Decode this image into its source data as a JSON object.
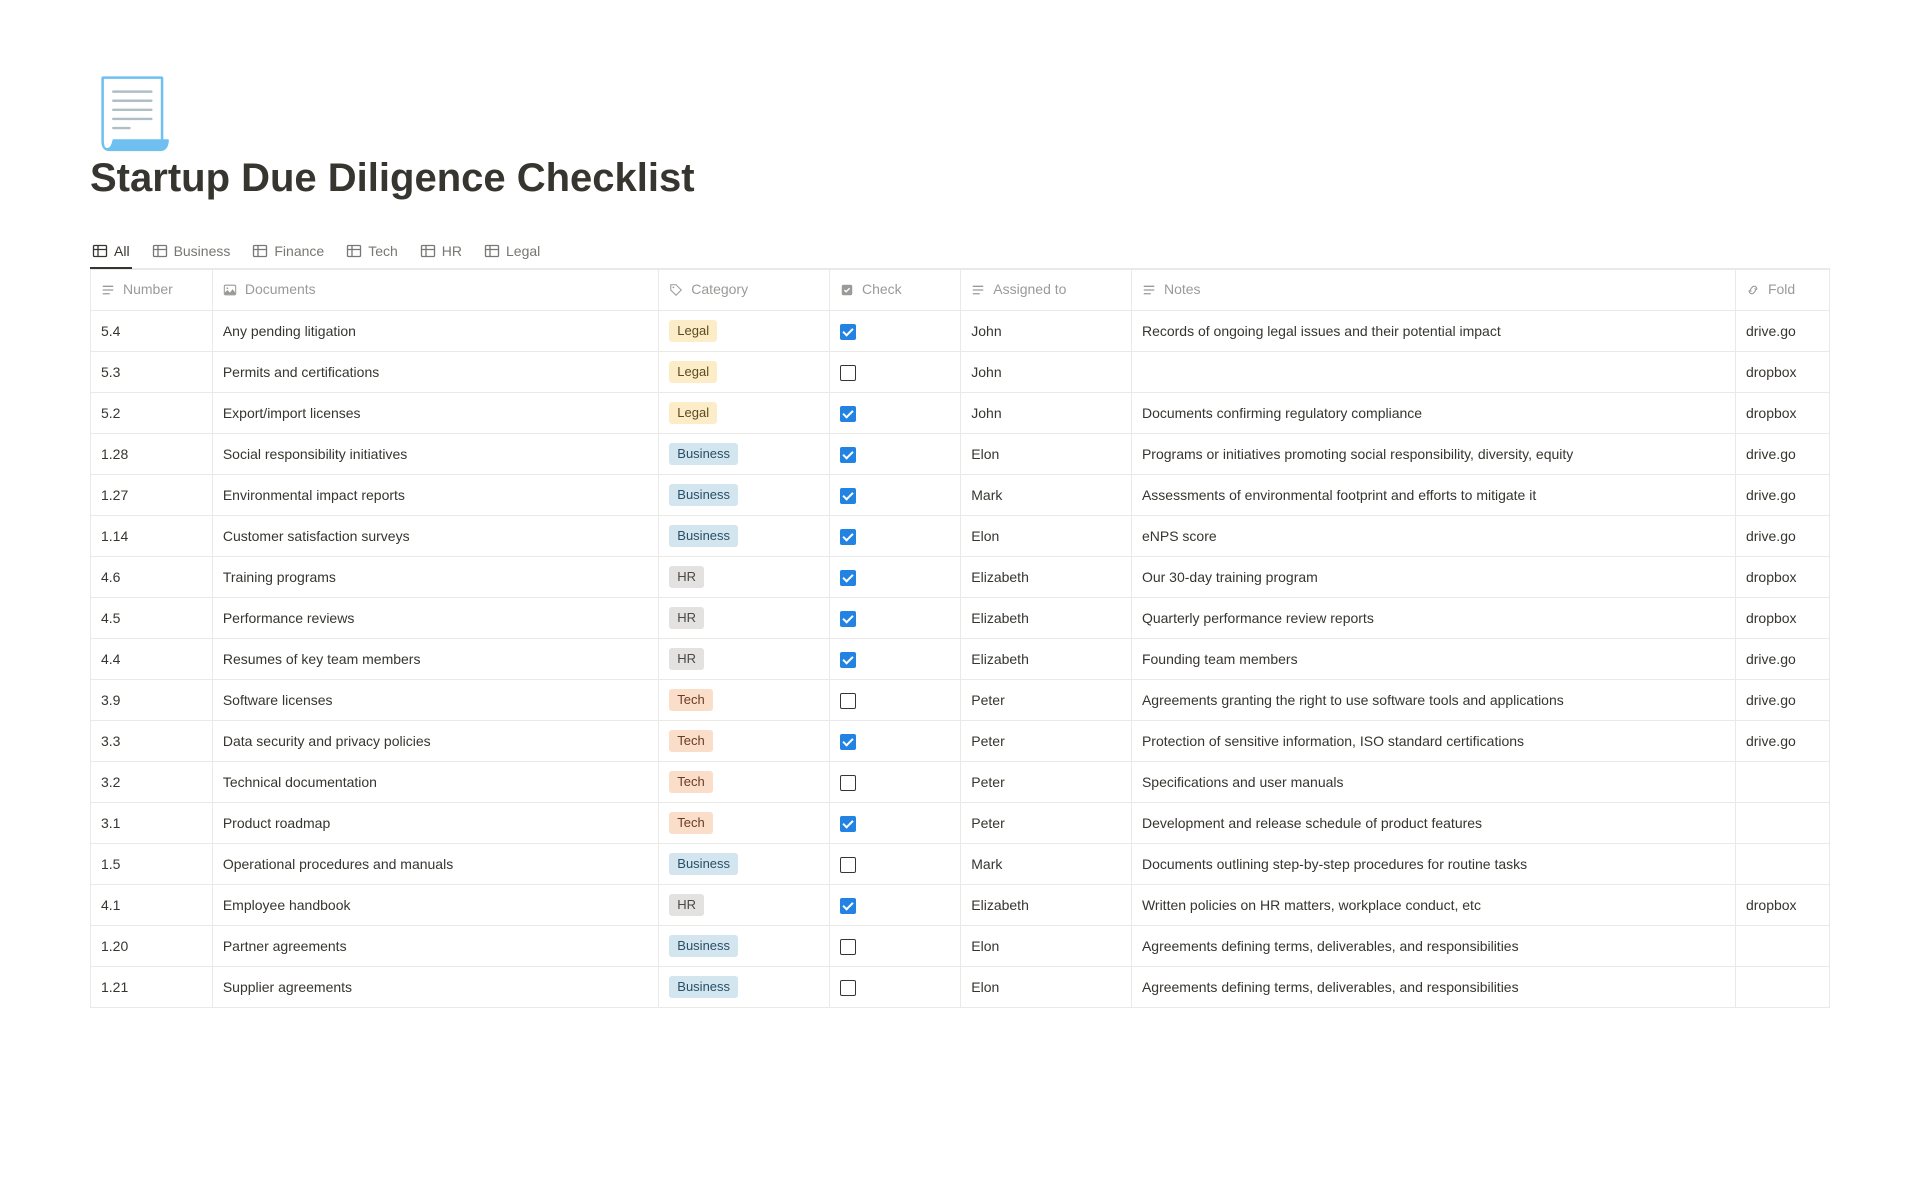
{
  "page": {
    "icon": "📃",
    "title": "Startup Due Diligence Checklist"
  },
  "tabs": [
    {
      "label": "All",
      "active": true
    },
    {
      "label": "Business",
      "active": false
    },
    {
      "label": "Finance",
      "active": false
    },
    {
      "label": "Tech",
      "active": false
    },
    {
      "label": "HR",
      "active": false
    },
    {
      "label": "Legal",
      "active": false
    }
  ],
  "columns": {
    "number": "Number",
    "documents": "Documents",
    "category": "Category",
    "check": "Check",
    "assigned": "Assigned to",
    "notes": "Notes",
    "folder": "Fold"
  },
  "category_styles": {
    "Legal": "tag-legal",
    "Business": "tag-business",
    "HR": "tag-hr",
    "Tech": "tag-tech"
  },
  "rows": [
    {
      "number": "5.4",
      "documents": "Any pending litigation",
      "category": "Legal",
      "check": true,
      "assigned": "John",
      "notes": "Records of ongoing legal issues and their potential impact",
      "folder": "drive.go"
    },
    {
      "number": "5.3",
      "documents": "Permits and certifications",
      "category": "Legal",
      "check": false,
      "assigned": "John",
      "notes": "",
      "folder": "dropbox"
    },
    {
      "number": "5.2",
      "documents": "Export/import licenses",
      "category": "Legal",
      "check": true,
      "assigned": "John",
      "notes": "Documents confirming regulatory compliance",
      "folder": "dropbox"
    },
    {
      "number": "1.28",
      "documents": "Social responsibility initiatives",
      "category": "Business",
      "check": true,
      "assigned": "Elon",
      "notes": "Programs or initiatives promoting social responsibility, diversity, equity",
      "folder": "drive.go"
    },
    {
      "number": "1.27",
      "documents": "Environmental impact reports",
      "category": "Business",
      "check": true,
      "assigned": "Mark",
      "notes": "Assessments of environmental footprint and efforts to mitigate it",
      "folder": "drive.go"
    },
    {
      "number": "1.14",
      "documents": "Customer satisfaction surveys",
      "category": "Business",
      "check": true,
      "assigned": "Elon",
      "notes": "eNPS score",
      "folder": "drive.go"
    },
    {
      "number": "4.6",
      "documents": "Training programs",
      "category": "HR",
      "check": true,
      "assigned": "Elizabeth",
      "notes": "Our 30-day training program",
      "folder": "dropbox"
    },
    {
      "number": "4.5",
      "documents": "Performance reviews",
      "category": "HR",
      "check": true,
      "assigned": "Elizabeth",
      "notes": "Quarterly performance review reports",
      "folder": "dropbox"
    },
    {
      "number": "4.4",
      "documents": "Resumes of key team members",
      "category": "HR",
      "check": true,
      "assigned": "Elizabeth",
      "notes": "Founding team members",
      "folder": "drive.go"
    },
    {
      "number": "3.9",
      "documents": "Software licenses",
      "category": "Tech",
      "check": false,
      "assigned": "Peter",
      "notes": "Agreements granting the right to use software tools and applications",
      "folder": "drive.go"
    },
    {
      "number": "3.3",
      "documents": "Data security and privacy policies",
      "category": "Tech",
      "check": true,
      "assigned": "Peter",
      "notes": "Protection of sensitive information, ISO standard certifications",
      "folder": "drive.go"
    },
    {
      "number": "3.2",
      "documents": "Technical documentation",
      "category": "Tech",
      "check": false,
      "assigned": "Peter",
      "notes": "Specifications and user manuals",
      "folder": ""
    },
    {
      "number": "3.1",
      "documents": "Product roadmap",
      "category": "Tech",
      "check": true,
      "assigned": "Peter",
      "notes": "Development and release schedule of product features",
      "folder": ""
    },
    {
      "number": "1.5",
      "documents": "Operational procedures and manuals",
      "category": "Business",
      "check": false,
      "assigned": "Mark",
      "notes": "Documents outlining step-by-step procedures for routine tasks",
      "folder": ""
    },
    {
      "number": "4.1",
      "documents": "Employee handbook",
      "category": "HR",
      "check": true,
      "assigned": "Elizabeth",
      "notes": "Written policies on HR matters, workplace conduct, etc",
      "folder": "dropbox"
    },
    {
      "number": "1.20",
      "documents": "Partner agreements",
      "category": "Business",
      "check": false,
      "assigned": "Elon",
      "notes": "Agreements defining terms, deliverables, and responsibilities",
      "folder": ""
    },
    {
      "number": "1.21",
      "documents": "Supplier agreements",
      "category": "Business",
      "check": false,
      "assigned": "Elon",
      "notes": "Agreements defining terms, deliverables, and responsibilities",
      "folder": ""
    }
  ]
}
